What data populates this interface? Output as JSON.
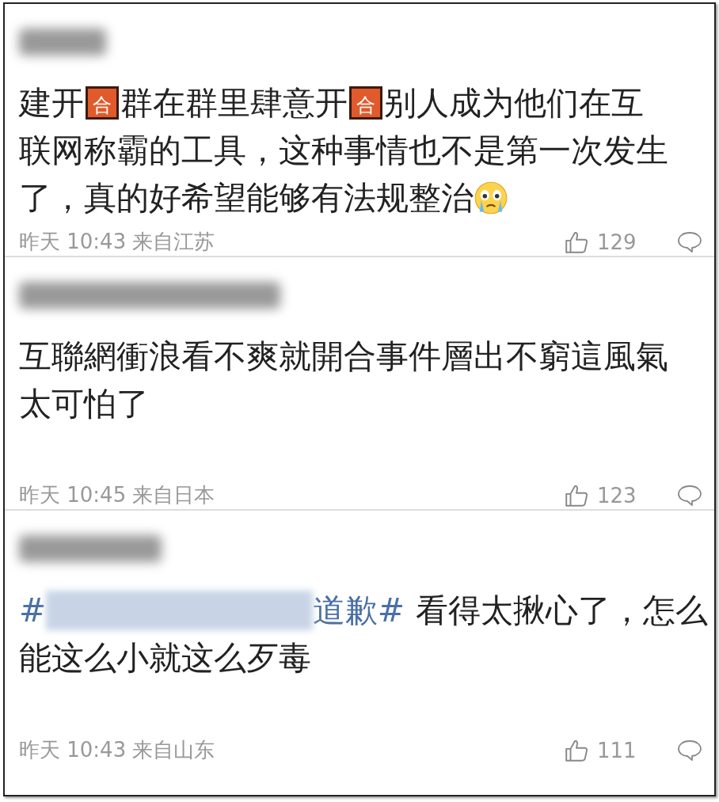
{
  "comments": [
    {
      "author_hidden": true,
      "lines": [
        [
          {
            "kind": "text",
            "text": "建开"
          },
          {
            "kind": "badge",
            "text": "合"
          },
          {
            "kind": "text",
            "text": "群在群里肆意开"
          },
          {
            "kind": "badge",
            "text": "合"
          },
          {
            "kind": "text",
            "text": "别人成为他们在互"
          }
        ],
        [
          {
            "kind": "text",
            "text": "联网称霸的工具，这种事情也不是第一次发生"
          }
        ],
        [
          {
            "kind": "text",
            "text": "了，真的好希望能够有法规整治"
          },
          {
            "kind": "emoji"
          }
        ]
      ],
      "time": "昨天 10:43 来自江苏",
      "likes": "129"
    },
    {
      "author_hidden": true,
      "lines": [
        [
          {
            "kind": "text",
            "text": "互聯網衝浪看不爽就開合事件層出不窮這風氣"
          }
        ],
        [
          {
            "kind": "text",
            "text": "太可怕了"
          }
        ]
      ],
      "time": "昨天 10:45 来自日本",
      "likes": "123"
    },
    {
      "author_hidden": true,
      "lines": [
        [
          {
            "kind": "tag",
            "text": "#"
          },
          {
            "kind": "redacted"
          },
          {
            "kind": "tag",
            "text": "道歉#"
          },
          {
            "kind": "text",
            "text": "看得太揪心了，怎么"
          }
        ],
        [
          {
            "kind": "text",
            "text": "能这么小就这么歹毒"
          }
        ]
      ],
      "time": "昨天 10:43 来自山东",
      "likes": "111"
    }
  ]
}
